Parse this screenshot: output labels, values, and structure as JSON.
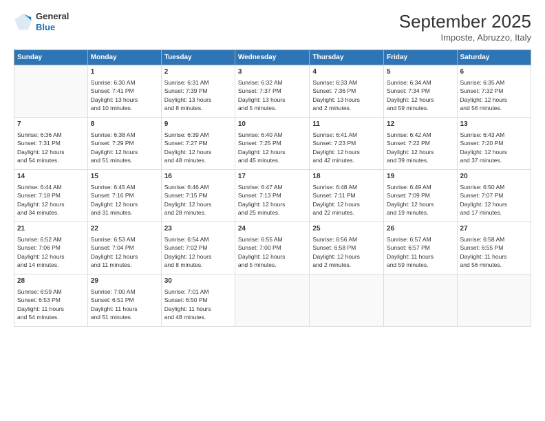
{
  "logo": {
    "general": "General",
    "blue": "Blue"
  },
  "header": {
    "month": "September 2025",
    "location": "Imposte, Abruzzo, Italy"
  },
  "weekdays": [
    "Sunday",
    "Monday",
    "Tuesday",
    "Wednesday",
    "Thursday",
    "Friday",
    "Saturday"
  ],
  "weeks": [
    [
      {
        "day": "",
        "info": ""
      },
      {
        "day": "1",
        "info": "Sunrise: 6:30 AM\nSunset: 7:41 PM\nDaylight: 13 hours\nand 10 minutes."
      },
      {
        "day": "2",
        "info": "Sunrise: 6:31 AM\nSunset: 7:39 PM\nDaylight: 13 hours\nand 8 minutes."
      },
      {
        "day": "3",
        "info": "Sunrise: 6:32 AM\nSunset: 7:37 PM\nDaylight: 13 hours\nand 5 minutes."
      },
      {
        "day": "4",
        "info": "Sunrise: 6:33 AM\nSunset: 7:36 PM\nDaylight: 13 hours\nand 2 minutes."
      },
      {
        "day": "5",
        "info": "Sunrise: 6:34 AM\nSunset: 7:34 PM\nDaylight: 12 hours\nand 59 minutes."
      },
      {
        "day": "6",
        "info": "Sunrise: 6:35 AM\nSunset: 7:32 PM\nDaylight: 12 hours\nand 56 minutes."
      }
    ],
    [
      {
        "day": "7",
        "info": "Sunrise: 6:36 AM\nSunset: 7:31 PM\nDaylight: 12 hours\nand 54 minutes."
      },
      {
        "day": "8",
        "info": "Sunrise: 6:38 AM\nSunset: 7:29 PM\nDaylight: 12 hours\nand 51 minutes."
      },
      {
        "day": "9",
        "info": "Sunrise: 6:39 AM\nSunset: 7:27 PM\nDaylight: 12 hours\nand 48 minutes."
      },
      {
        "day": "10",
        "info": "Sunrise: 6:40 AM\nSunset: 7:25 PM\nDaylight: 12 hours\nand 45 minutes."
      },
      {
        "day": "11",
        "info": "Sunrise: 6:41 AM\nSunset: 7:23 PM\nDaylight: 12 hours\nand 42 minutes."
      },
      {
        "day": "12",
        "info": "Sunrise: 6:42 AM\nSunset: 7:22 PM\nDaylight: 12 hours\nand 39 minutes."
      },
      {
        "day": "13",
        "info": "Sunrise: 6:43 AM\nSunset: 7:20 PM\nDaylight: 12 hours\nand 37 minutes."
      }
    ],
    [
      {
        "day": "14",
        "info": "Sunrise: 6:44 AM\nSunset: 7:18 PM\nDaylight: 12 hours\nand 34 minutes."
      },
      {
        "day": "15",
        "info": "Sunrise: 6:45 AM\nSunset: 7:16 PM\nDaylight: 12 hours\nand 31 minutes."
      },
      {
        "day": "16",
        "info": "Sunrise: 6:46 AM\nSunset: 7:15 PM\nDaylight: 12 hours\nand 28 minutes."
      },
      {
        "day": "17",
        "info": "Sunrise: 6:47 AM\nSunset: 7:13 PM\nDaylight: 12 hours\nand 25 minutes."
      },
      {
        "day": "18",
        "info": "Sunrise: 6:48 AM\nSunset: 7:11 PM\nDaylight: 12 hours\nand 22 minutes."
      },
      {
        "day": "19",
        "info": "Sunrise: 6:49 AM\nSunset: 7:09 PM\nDaylight: 12 hours\nand 19 minutes."
      },
      {
        "day": "20",
        "info": "Sunrise: 6:50 AM\nSunset: 7:07 PM\nDaylight: 12 hours\nand 17 minutes."
      }
    ],
    [
      {
        "day": "21",
        "info": "Sunrise: 6:52 AM\nSunset: 7:06 PM\nDaylight: 12 hours\nand 14 minutes."
      },
      {
        "day": "22",
        "info": "Sunrise: 6:53 AM\nSunset: 7:04 PM\nDaylight: 12 hours\nand 11 minutes."
      },
      {
        "day": "23",
        "info": "Sunrise: 6:54 AM\nSunset: 7:02 PM\nDaylight: 12 hours\nand 8 minutes."
      },
      {
        "day": "24",
        "info": "Sunrise: 6:55 AM\nSunset: 7:00 PM\nDaylight: 12 hours\nand 5 minutes."
      },
      {
        "day": "25",
        "info": "Sunrise: 6:56 AM\nSunset: 6:58 PM\nDaylight: 12 hours\nand 2 minutes."
      },
      {
        "day": "26",
        "info": "Sunrise: 6:57 AM\nSunset: 6:57 PM\nDaylight: 11 hours\nand 59 minutes."
      },
      {
        "day": "27",
        "info": "Sunrise: 6:58 AM\nSunset: 6:55 PM\nDaylight: 11 hours\nand 56 minutes."
      }
    ],
    [
      {
        "day": "28",
        "info": "Sunrise: 6:59 AM\nSunset: 6:53 PM\nDaylight: 11 hours\nand 54 minutes."
      },
      {
        "day": "29",
        "info": "Sunrise: 7:00 AM\nSunset: 6:51 PM\nDaylight: 11 hours\nand 51 minutes."
      },
      {
        "day": "30",
        "info": "Sunrise: 7:01 AM\nSunset: 6:50 PM\nDaylight: 11 hours\nand 48 minutes."
      },
      {
        "day": "",
        "info": ""
      },
      {
        "day": "",
        "info": ""
      },
      {
        "day": "",
        "info": ""
      },
      {
        "day": "",
        "info": ""
      }
    ]
  ]
}
